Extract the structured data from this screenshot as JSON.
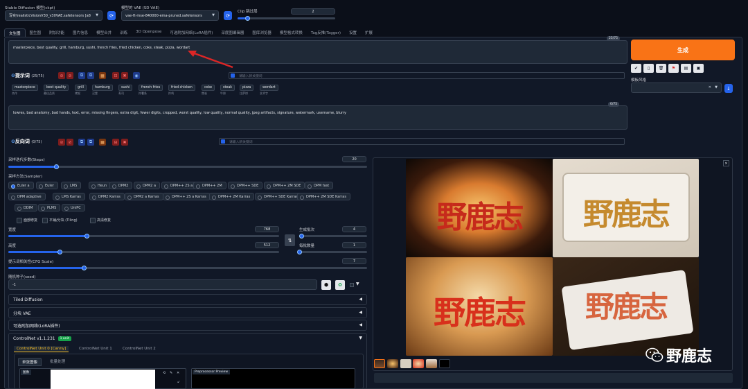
{
  "models": {
    "ckpt_label": "Stable Diffusion 模型(ckpt)",
    "ckpt_value": "写实\\realisticVisionV30_v30VAE.safetensors [a8",
    "vae_label": "模型的 VAE (SD VAE)",
    "vae_value": "vae-ft-mse-840000-ema-pruned.safetensors",
    "clip_label": "Clip 跳过层",
    "clip_value": "2"
  },
  "tabs": [
    "文生图",
    "图生图",
    "附加功能",
    "图片信息",
    "模型合并",
    "训练",
    "3D Openpose",
    "可选附加网络(LoRA插件)",
    "深度图编辑器",
    "图库浏览器",
    "模型格式转换",
    "Tag反推(Tagger)",
    "设置",
    "扩展"
  ],
  "prompt": {
    "text": "masterpiece, best quality, grill, hamburg, sushi, french fries, fried chicken, coke, steak, pizza, wordart",
    "count": "25/75",
    "section_label": "提示词",
    "section_count": "(25/75)",
    "keyword_placeholder": "请输入新关键词"
  },
  "prompt_chips": [
    {
      "t": "masterpiece",
      "s": "杰作"
    },
    {
      "t": "best quality",
      "s": "最佳品质"
    },
    {
      "t": "grill",
      "s": "烤架"
    },
    {
      "t": "hamburg",
      "s": "汉堡"
    },
    {
      "t": "sushi",
      "s": "寿司"
    },
    {
      "t": "french fries",
      "s": "炸薯条"
    },
    {
      "t": "fried chicken",
      "s": "炸鸡"
    },
    {
      "t": "coke",
      "s": "焦炭"
    },
    {
      "t": "steak",
      "s": "牛排"
    },
    {
      "t": "pizza",
      "s": "比萨饼"
    },
    {
      "t": "wordart",
      "s": "艺术字"
    }
  ],
  "negative": {
    "text": "lowres, bad anatomy, bad hands, text, error, missing fingers, extra digit, fewer digits, cropped, worst quality, low quality, normal quality, jpeg artifacts, signature, watermark, username, blurry",
    "count": "0/75",
    "section_label": "反向词",
    "section_count": "(0/75)",
    "keyword_placeholder": "请输入新关键词"
  },
  "generate": {
    "label": "生成",
    "style_label": "模板风格",
    "style_close": "✕"
  },
  "steps": {
    "label": "采样迭代步数(Steps)",
    "value": "20",
    "min": 1,
    "max": 150
  },
  "sampler": {
    "label": "采样方法(Sampler)",
    "options": [
      "Euler a",
      "Euler",
      "LMS",
      "Heun",
      "DPM2",
      "DPM2 a",
      "DPM++ 2S a",
      "DPM++ 2M",
      "DPM++ SDE",
      "DPM++ 2M SDE",
      "DPM fast",
      "DPM adaptive",
      "LMS Karras",
      "DPM2 Karras",
      "DPM2 a Karras",
      "DPM++ 2S a Karras",
      "DPM++ 2M Karras",
      "DPM++ SDE Karras",
      "DPM++ 2M SDE Karras",
      "DDIM",
      "PLMS",
      "UniPC"
    ],
    "selected": "Euler a"
  },
  "options": {
    "restore_faces": "面部修复",
    "tiling": "平铺/分块 (Tiling)",
    "hires": "高清修复"
  },
  "width": {
    "label": "宽度",
    "value": "768",
    "fraction": 0.29
  },
  "height": {
    "label": "高度",
    "value": "512",
    "fraction": 0.19
  },
  "batch_count": {
    "label": "生成批次",
    "value": "4",
    "fraction": 0.03
  },
  "batch_size": {
    "label": "每批数量",
    "value": "1",
    "fraction": 0.0
  },
  "cfg": {
    "label": "提示词相关性(CFG Scale)",
    "value": "7",
    "fraction": 0.21
  },
  "seed": {
    "label": "随机种子(seed)",
    "value": "-1"
  },
  "accordions": {
    "tiled": "Tiled Diffusion",
    "vae": "分块 VAE",
    "lora": "可选附加网络(LoRA插件)"
  },
  "controlnet": {
    "title": "ControlNet v1.1.231",
    "badge": "1 unit",
    "tabs": [
      "ControlNet Unit 0 [Canny]",
      "ControlNet Unit 1",
      "ControlNet Unit 2"
    ],
    "subtabs": [
      "单张图像",
      "批量处理"
    ],
    "image_label": "图像",
    "preview_label": "Preprocessor Preview"
  },
  "watermark": "野鹿志",
  "output_images": [
    "野鹿志",
    "野鹿志",
    "野鹿志",
    "野鹿志"
  ],
  "colors": {
    "accent": "#2563eb",
    "generate": "#f97316",
    "bg": "#0b0f19",
    "arrow": "#dc2626"
  }
}
